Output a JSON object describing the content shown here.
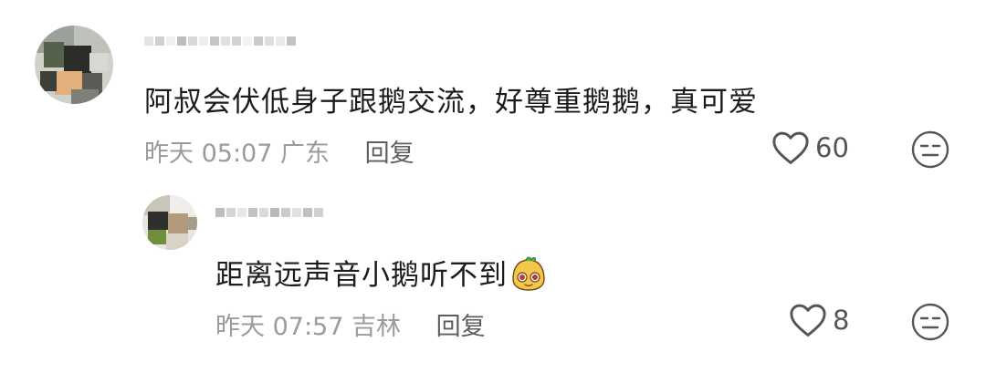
{
  "comments": [
    {
      "text": "阿叔会伏低身子跟鹅交流，好尊重鹅鹅，真可爱",
      "time": "昨天 05:07",
      "location": "广东",
      "reply_label": "回复",
      "likes": "60",
      "avatar_icon": "user-avatar-blurred",
      "username_icon": "blurred-username"
    },
    {
      "text": "距离远声音小鹅听不到",
      "time": "昨天 07:57",
      "location": "吉林",
      "reply_label": "回复",
      "likes": "8",
      "avatar_icon": "user-avatar-blurred",
      "username_icon": "blurred-username",
      "trailing_emoji": "cute-face-emoji"
    }
  ],
  "colors": {
    "text_primary": "#1c1c1c",
    "text_meta": "#9b9b9b",
    "text_reply": "#5e5e5e",
    "icon": "#555555"
  }
}
